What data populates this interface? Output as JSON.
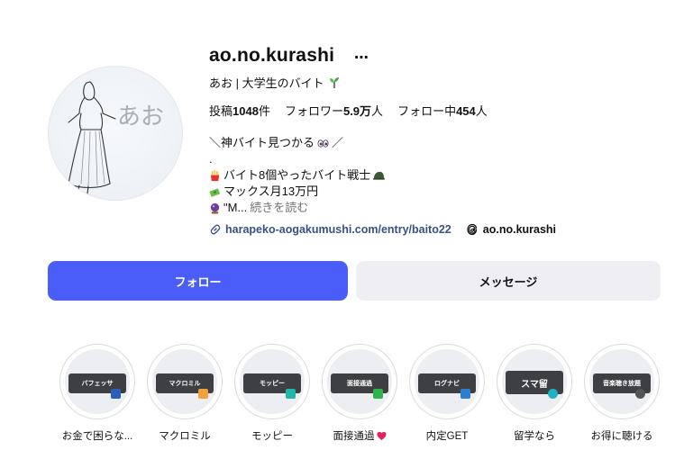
{
  "profile": {
    "username": "ao.no.kurashi",
    "more_icon": "⋯",
    "fullname": "あお | 大学生のバイト",
    "avatar_text": "あお"
  },
  "stats": {
    "posts_label": "投稿",
    "posts_value": "1048",
    "posts_unit": "件",
    "followers_label": "フォロワー",
    "followers_value": "5.9万",
    "followers_unit": "人",
    "following_label": "フォロー中",
    "following_value": "454",
    "following_unit": "人"
  },
  "bio": {
    "line1_a": "＼神バイト見つかる",
    "line1_b": "／",
    "line2": ".",
    "line3": "バイト8個やったバイト戦士",
    "line4": "マックス月13万円",
    "line5": "\"M...",
    "more": "続きを読む"
  },
  "links": {
    "url": "harapeko-aogakumushi.com/entry/baito22",
    "threads": "ao.no.kurashi"
  },
  "buttons": {
    "follow": "フォロー",
    "message": "メッセージ"
  },
  "highlights": [
    {
      "label": "お金で困らな...",
      "band": "バフェッサ",
      "badge": "#2b5fb8"
    },
    {
      "label": "マクロミル",
      "band": "マクロミル",
      "badge": "#f2a23a"
    },
    {
      "label": "モッピー",
      "band": "モッピー",
      "badge": "#22b6a8"
    },
    {
      "label": "面接通過",
      "band": "面接通過",
      "badge": "#2fb34a"
    },
    {
      "label": "内定GET",
      "band": "ログナビ",
      "badge": "#2a7fd0"
    },
    {
      "label": "留学なら",
      "band": "スマ留",
      "badge": "#21b0c5"
    },
    {
      "label": "お得に聴ける",
      "band": "音楽聴き放題",
      "badge": "#555555"
    }
  ],
  "colors": {
    "accent": "#4a5df9",
    "link": "#385185",
    "secondary_button": "#efeff3"
  }
}
